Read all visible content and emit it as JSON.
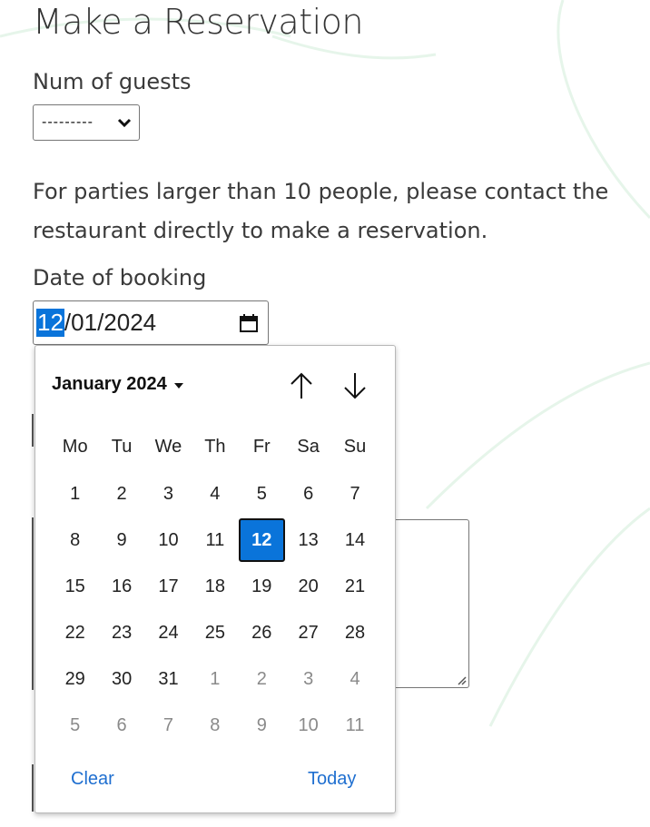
{
  "page": {
    "title": "Make a Reservation"
  },
  "guests": {
    "label": "Num of guests",
    "selected": "---------"
  },
  "info": {
    "text": "For parties larger than 10 people, please contact the restaurant directly to make a reservation."
  },
  "booking_date": {
    "label": "Date of booking",
    "value_month_selected": "12",
    "value_rest": "/01/2024"
  },
  "datepicker": {
    "month_label": "January 2024",
    "weekdays": [
      "Mo",
      "Tu",
      "We",
      "Th",
      "Fr",
      "Sa",
      "Su"
    ],
    "weeks": [
      [
        "1",
        "2",
        "3",
        "4",
        "5",
        "6",
        "7"
      ],
      [
        "8",
        "9",
        "10",
        "11",
        "12",
        "13",
        "14"
      ],
      [
        "15",
        "16",
        "17",
        "18",
        "19",
        "20",
        "21"
      ],
      [
        "22",
        "23",
        "24",
        "25",
        "26",
        "27",
        "28"
      ],
      [
        "29",
        "30",
        "31",
        "1",
        "2",
        "3",
        "4"
      ],
      [
        "5",
        "6",
        "7",
        "8",
        "9",
        "10",
        "11"
      ]
    ],
    "selected_day": "12",
    "clear_label": "Clear",
    "today_label": "Today"
  },
  "colors": {
    "accent": "#0a74da",
    "link": "#1f6fd0",
    "decor_green": "#e6f5ea"
  },
  "icons": {
    "dropdown": "chevron-down-icon",
    "calendar": "calendar-icon",
    "prev_month": "arrow-up-icon",
    "next_month": "arrow-down-icon"
  }
}
